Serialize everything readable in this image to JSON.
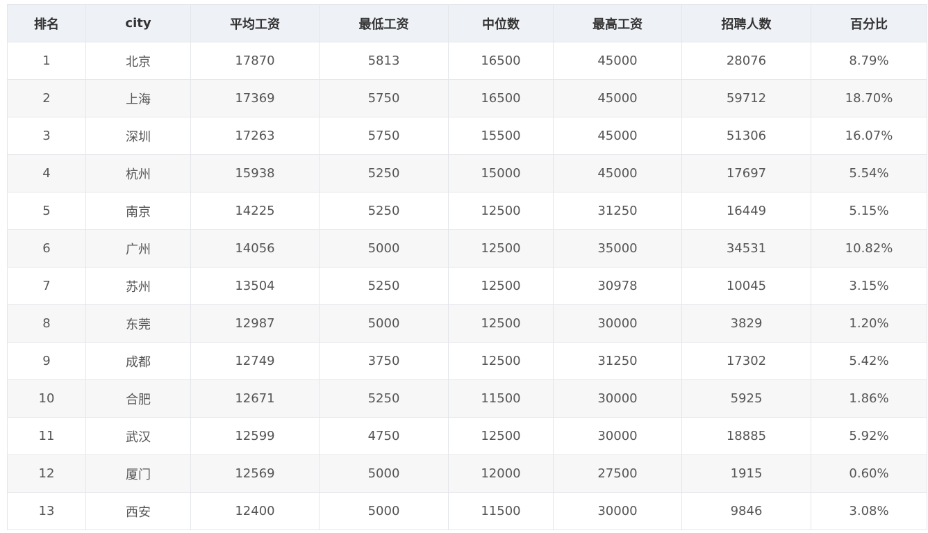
{
  "table": {
    "headers": [
      "排名",
      "city",
      "平均工资",
      "最低工资",
      "中位数",
      "最高工资",
      "招聘人数",
      "百分比"
    ],
    "rows": [
      [
        "1",
        "北京",
        "17870",
        "5813",
        "16500",
        "45000",
        "28076",
        "8.79%"
      ],
      [
        "2",
        "上海",
        "17369",
        "5750",
        "16500",
        "45000",
        "59712",
        "18.70%"
      ],
      [
        "3",
        "深圳",
        "17263",
        "5750",
        "15500",
        "45000",
        "51306",
        "16.07%"
      ],
      [
        "4",
        "杭州",
        "15938",
        "5250",
        "15000",
        "45000",
        "17697",
        "5.54%"
      ],
      [
        "5",
        "南京",
        "14225",
        "5250",
        "12500",
        "31250",
        "16449",
        "5.15%"
      ],
      [
        "6",
        "广州",
        "14056",
        "5000",
        "12500",
        "35000",
        "34531",
        "10.82%"
      ],
      [
        "7",
        "苏州",
        "13504",
        "5250",
        "12500",
        "30978",
        "10045",
        "3.15%"
      ],
      [
        "8",
        "东莞",
        "12987",
        "5000",
        "12500",
        "30000",
        "3829",
        "1.20%"
      ],
      [
        "9",
        "成都",
        "12749",
        "3750",
        "12500",
        "31250",
        "17302",
        "5.42%"
      ],
      [
        "10",
        "合肥",
        "12671",
        "5250",
        "11500",
        "30000",
        "5925",
        "1.86%"
      ],
      [
        "11",
        "武汉",
        "12599",
        "4750",
        "12500",
        "30000",
        "18885",
        "5.92%"
      ],
      [
        "12",
        "厦门",
        "12569",
        "5000",
        "12000",
        "27500",
        "1915",
        "0.60%"
      ],
      [
        "13",
        "西安",
        "12400",
        "5000",
        "11500",
        "30000",
        "9846",
        "3.08%"
      ]
    ]
  }
}
